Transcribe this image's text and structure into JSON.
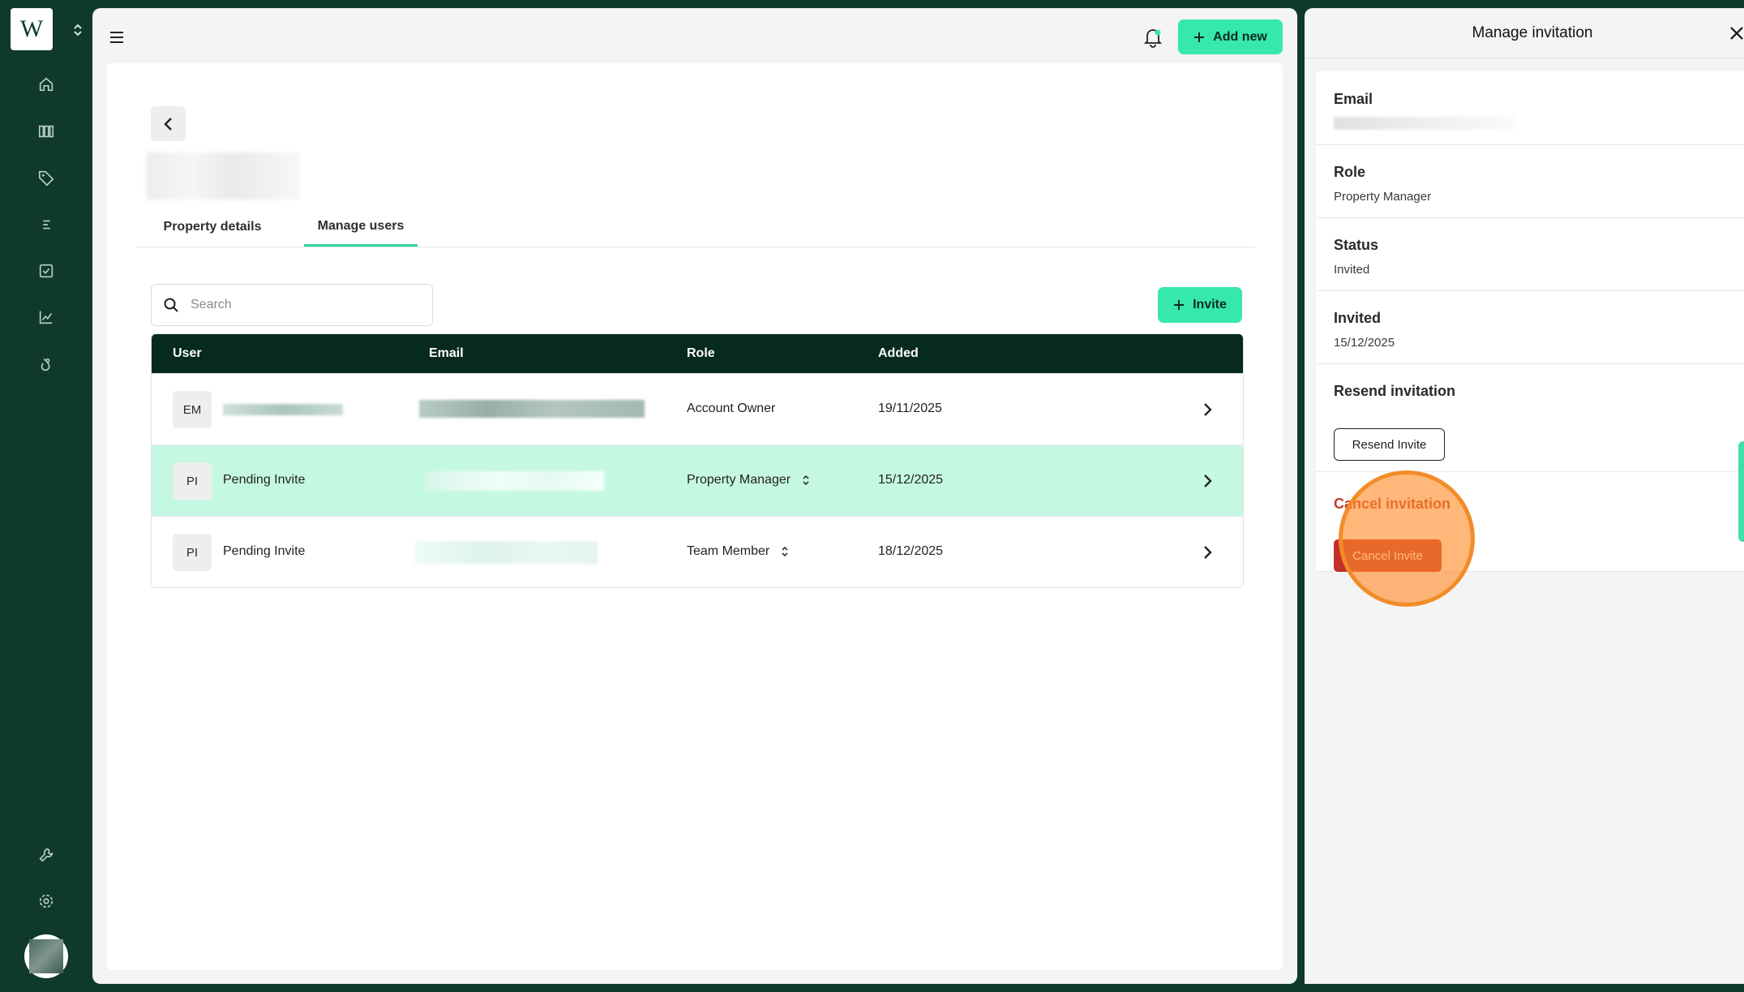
{
  "app": {
    "logo_letter": "W",
    "accent": "#36e8ab",
    "nav_bg": "#0f3a2b"
  },
  "header": {
    "add_new_label": "Add new"
  },
  "page": {
    "tabs": [
      {
        "label": "Property details",
        "active": false
      },
      {
        "label": "Manage users",
        "active": true
      }
    ],
    "search": {
      "placeholder": "Search",
      "value": ""
    },
    "invite_label": "Invite",
    "table": {
      "columns": [
        "User",
        "Email",
        "Role",
        "Added"
      ],
      "rows": [
        {
          "initials": "EM",
          "name": "",
          "email": "",
          "role": "Account Owner",
          "added": "19/11/2025",
          "highlighted": false,
          "role_selectable": false
        },
        {
          "initials": "PI",
          "name": "Pending Invite",
          "email": "",
          "role": "Property Manager",
          "added": "15/12/2025",
          "highlighted": true,
          "role_selectable": true
        },
        {
          "initials": "PI",
          "name": "Pending Invite",
          "email": "",
          "role": "Team Member",
          "added": "18/12/2025",
          "highlighted": false,
          "role_selectable": true
        }
      ]
    }
  },
  "drawer": {
    "title": "Manage invitation",
    "email": {
      "label": "Email",
      "value": ""
    },
    "role": {
      "label": "Role",
      "value": "Property Manager"
    },
    "status": {
      "label": "Status",
      "value": "Invited"
    },
    "invited": {
      "label": "Invited",
      "value": "15/12/2025"
    },
    "resend": {
      "label": "Resend invitation",
      "button": "Resend Invite"
    },
    "cancel": {
      "label": "Cancel invitation",
      "button": "Cancel Invite",
      "color": "#c2302a"
    }
  }
}
